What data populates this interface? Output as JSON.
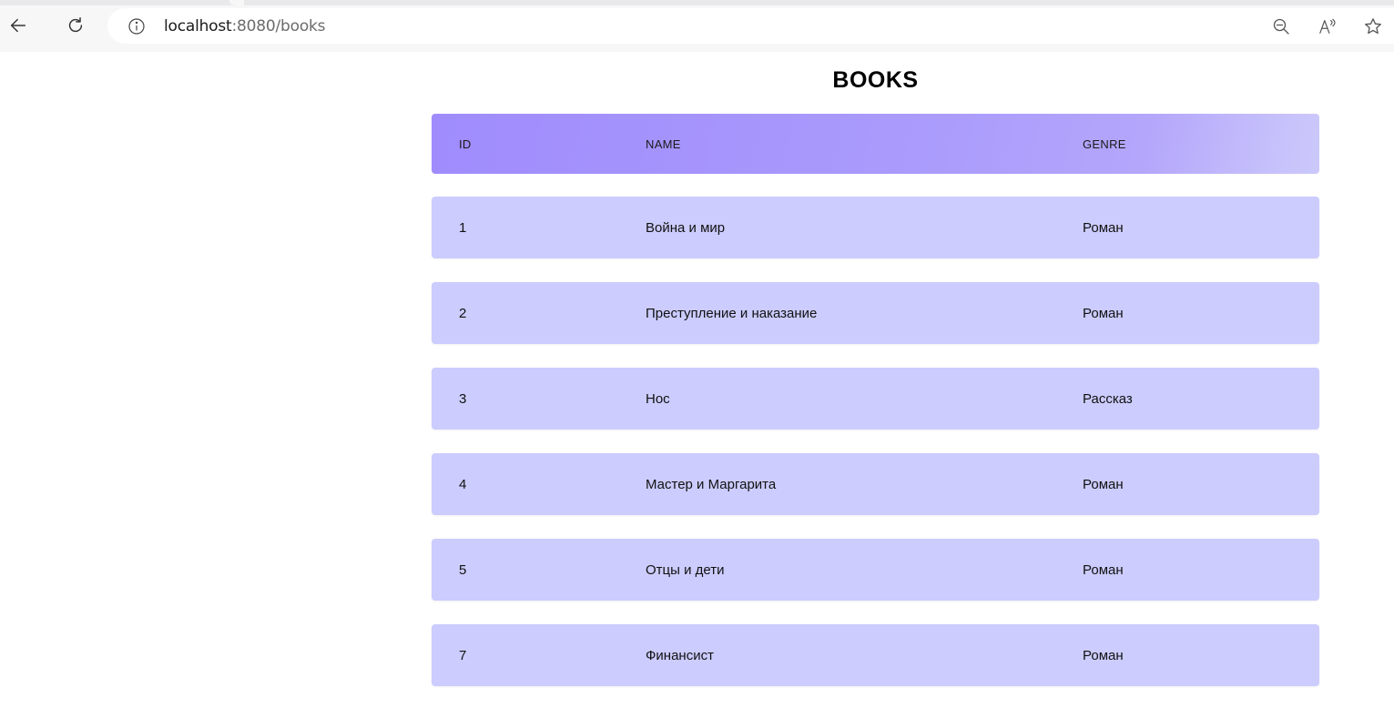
{
  "browser": {
    "url_host": "localhost",
    "url_rest": ":8080/books"
  },
  "page": {
    "title": "BOOKS"
  },
  "table": {
    "headers": {
      "id": "ID",
      "name": "NAME",
      "genre": "GENRE"
    },
    "rows": [
      {
        "id": "1",
        "name": "Война и мир",
        "genre": "Роман"
      },
      {
        "id": "2",
        "name": "Преступление и наказание",
        "genre": "Роман"
      },
      {
        "id": "3",
        "name": "Нос",
        "genre": "Рассказ"
      },
      {
        "id": "4",
        "name": "Мастер и Маргарита",
        "genre": "Роман"
      },
      {
        "id": "5",
        "name": "Отцы и дети",
        "genre": "Роман"
      },
      {
        "id": "7",
        "name": "Финансист",
        "genre": "Роман"
      }
    ]
  },
  "colors": {
    "header_gradient_start": "#a08cfd",
    "header_gradient_end": "#cbc8fb",
    "row_background": "#ccccff"
  }
}
